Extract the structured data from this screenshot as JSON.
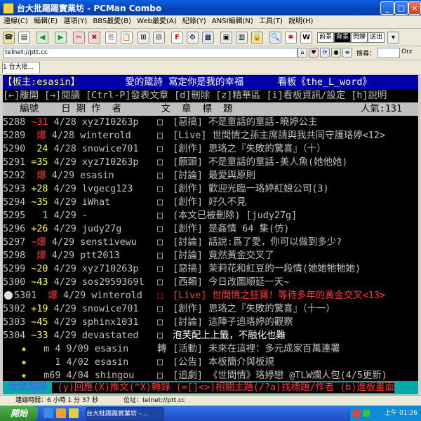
{
  "window": {
    "title": "台大批踢踢實業坊 - PCMan Combo"
  },
  "menubar": {
    "items": [
      "連線(C)",
      "編輯(E)",
      "選項(Y)",
      "BBS最愛(B)",
      "Web最愛(A)",
      "紀錄(Y)",
      "ANSI編輯(N)",
      "工具(T)",
      "說明(H)"
    ]
  },
  "toolbar": {
    "front_label": "前景",
    "back_label": "背景",
    "blink_label": "閃爍",
    "send_label": "送出"
  },
  "address": {
    "value": "telnet://ptt.cc",
    "search_label": "搜尋：",
    "search_placeholder": "",
    "engine_label": "Orz"
  },
  "tabs": [
    {
      "label": "1 台大批..."
    }
  ],
  "terminal": {
    "header": {
      "moderator": "【板主:esasin】",
      "slogan": "愛的箴詩 寫定你是我的幸福",
      "board": "看板《the_L_word》"
    },
    "helpline": "[←]離開 [→]閱讀 [Ctrl-P]發表文章 [d]刪除 [z]精華區 [i]看板資訊/設定 [h]說明",
    "colheader": {
      "label": "   編號    日 期 作  者       文  章  標  題",
      "popularity": "人氣:131"
    },
    "posts": [
      {
        "num": "5288",
        "mark": " ~31",
        "date": "4/28",
        "author": "xyz710263p",
        "box": "□",
        "title": " [惡搞] 不是童話的童話-曉婷公主"
      },
      {
        "num": "5289",
        "mark": "  爆",
        "date": "4/28",
        "author": "winterold",
        "box": "□",
        "title": " [Live] 世間情之孫主席請與我共同守護珞婷<12>"
      },
      {
        "num": "5290",
        "mark": "  24",
        "date": "4/28",
        "author": "snowice701",
        "box": "□",
        "title": " [創作] 思珞之『失敗的驚喜』（十）"
      },
      {
        "num": "5291",
        "mark": " =35",
        "date": "4/29",
        "author": "xyz710263p",
        "box": "□",
        "title": " [願頭] 不是童話的童話-美人魚(她他她)"
      },
      {
        "num": "5292",
        "mark": "  爆",
        "date": "4/29",
        "author": "esasin",
        "box": "□",
        "title": " [討論] 最愛與原則"
      },
      {
        "num": "5293",
        "mark": " +28",
        "date": "4/29",
        "author": "lvgecg123",
        "box": "□",
        "title": " [創作] 歡迎光臨一珞婷紅娘公司(3)"
      },
      {
        "num": "5294",
        "mark": " ~35",
        "date": "4/29",
        "author": "iWhat",
        "box": "□",
        "title": " [創作] 好久不見"
      },
      {
        "num": "5295",
        "mark": "   1",
        "date": "4/29",
        "author": "-",
        "box": "□",
        "title": " (本文已被刪除) [judy27g]"
      },
      {
        "num": "5296",
        "mark": " +26",
        "date": "4/29",
        "author": "judy27g",
        "box": "□",
        "title": " [創作] 是姦情 64 集(仿)"
      },
      {
        "num": "5297",
        "mark": " ~爆",
        "date": "4/29",
        "author": "senstivewu",
        "box": "□",
        "title": " [討論] 話說:爲了愛，你可以做到多少?"
      },
      {
        "num": "5298",
        "mark": "  爆",
        "date": "4/29",
        "author": "ptt2013",
        "box": "□",
        "title": " [討論] 竟然黃金交叉了"
      },
      {
        "num": "5299",
        "mark": " ~20",
        "date": "4/29",
        "author": "xyz710263p",
        "box": "□",
        "title": " [惡搞] 茉莉花和紅豆的一段情(她她牠牠她)"
      },
      {
        "num": "5300",
        "mark": " ~43",
        "date": "4/29",
        "author": "sos2959369l",
        "box": "□",
        "title": " [西類] 今日改圖順延一天~"
      },
      {
        "num": "5301",
        "mark": "  爆",
        "date": "4/29",
        "author": "winterold",
        "box": "□",
        "title": " [Live] 世間情之狂寶！等待多年的黃金交叉<13>"
      },
      {
        "num": "5302",
        "mark": " +19",
        "date": "4/29",
        "author": "snowice701",
        "box": "□",
        "title": " [創作] 思珞之『失敗的驚喜』（十一）"
      },
      {
        "num": "5303",
        "mark": " ~45",
        "date": "4/29",
        "author": "sphinx1031",
        "box": "□",
        "title": " [討論] 這陣子追珞婷的觀察"
      },
      {
        "num": "5304",
        "mark": " ~33",
        "date": "4/29",
        "author": "devastated",
        "box": "□",
        "title": " 泡芙配上上籤，不融化也難"
      },
      {
        "num": "★",
        "mark": "   m 4",
        "date": "9/09",
        "author": "esasin",
        "box": "轉",
        "title": " [活動] 未來在這裡：多元成家百萬連署"
      },
      {
        "num": "★",
        "mark": "     1",
        "date": "4/02",
        "author": "esasin",
        "box": "□",
        "title": " [公告] 本板簡介與板規"
      },
      {
        "num": "★",
        "mark": "   m69",
        "date": "4/04",
        "author": "shingou",
        "box": "□",
        "title": " [追劇] 《世間情》珞婷戀 @TLW爛人包(4/5更新)"
      }
    ],
    "footer": {
      "mode": " 文章選讀 ",
      "keys": " (y)回應(X)推文(^X)轉錄 (=[]<>)相關主題(/?a)找標題/作者 (b)進板畫面"
    }
  },
  "status": {
    "online": "連線時間：6 小時 1 分 37 秒",
    "location": "位址：telnet://ptt.cc"
  },
  "taskbar": {
    "start_label": "開始",
    "task_label": "台大批踢踢實業坊 -...",
    "clock": "上午 01:26"
  },
  "colors": {
    "title_blue": "#0a5fe0",
    "taskbar_blue": "#245edb",
    "term_bg": "#000000"
  }
}
